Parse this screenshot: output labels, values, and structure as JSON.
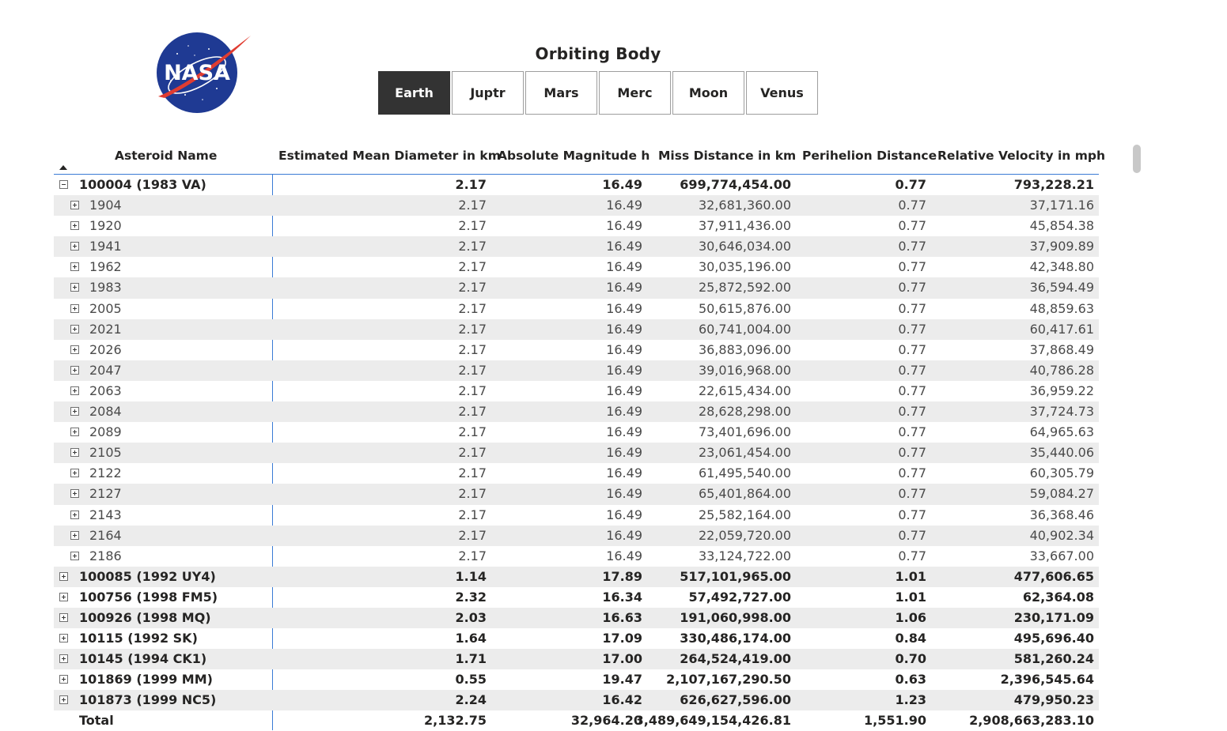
{
  "logo": {
    "text": "NASA"
  },
  "slicer": {
    "title": "Orbiting Body",
    "options": [
      "Earth",
      "Juptr",
      "Mars",
      "Merc",
      "Moon",
      "Venus"
    ],
    "selected": "Earth"
  },
  "table": {
    "columns": [
      "Asteroid Name",
      "Estimated Mean Diameter in km",
      "Absolute Magnitude h",
      "Miss Distance in km",
      "Perihelion Distance",
      "Relative Velocity in mph"
    ],
    "rows": [
      {
        "level": "parent",
        "expanded": true,
        "name": "100004 (1983 VA)",
        "diameter": "2.17",
        "magnitude": "16.49",
        "miss": "699,774,454.00",
        "perihelion": "0.77",
        "velocity": "793,228.21"
      },
      {
        "level": "child",
        "name": "1904",
        "diameter": "2.17",
        "magnitude": "16.49",
        "miss": "32,681,360.00",
        "perihelion": "0.77",
        "velocity": "37,171.16"
      },
      {
        "level": "child",
        "name": "1920",
        "diameter": "2.17",
        "magnitude": "16.49",
        "miss": "37,911,436.00",
        "perihelion": "0.77",
        "velocity": "45,854.38"
      },
      {
        "level": "child",
        "name": "1941",
        "diameter": "2.17",
        "magnitude": "16.49",
        "miss": "30,646,034.00",
        "perihelion": "0.77",
        "velocity": "37,909.89"
      },
      {
        "level": "child",
        "name": "1962",
        "diameter": "2.17",
        "magnitude": "16.49",
        "miss": "30,035,196.00",
        "perihelion": "0.77",
        "velocity": "42,348.80"
      },
      {
        "level": "child",
        "name": "1983",
        "diameter": "2.17",
        "magnitude": "16.49",
        "miss": "25,872,592.00",
        "perihelion": "0.77",
        "velocity": "36,594.49"
      },
      {
        "level": "child",
        "name": "2005",
        "diameter": "2.17",
        "magnitude": "16.49",
        "miss": "50,615,876.00",
        "perihelion": "0.77",
        "velocity": "48,859.63"
      },
      {
        "level": "child",
        "name": "2021",
        "diameter": "2.17",
        "magnitude": "16.49",
        "miss": "60,741,004.00",
        "perihelion": "0.77",
        "velocity": "60,417.61"
      },
      {
        "level": "child",
        "name": "2026",
        "diameter": "2.17",
        "magnitude": "16.49",
        "miss": "36,883,096.00",
        "perihelion": "0.77",
        "velocity": "37,868.49"
      },
      {
        "level": "child",
        "name": "2047",
        "diameter": "2.17",
        "magnitude": "16.49",
        "miss": "39,016,968.00",
        "perihelion": "0.77",
        "velocity": "40,786.28"
      },
      {
        "level": "child",
        "name": "2063",
        "diameter": "2.17",
        "magnitude": "16.49",
        "miss": "22,615,434.00",
        "perihelion": "0.77",
        "velocity": "36,959.22"
      },
      {
        "level": "child",
        "name": "2084",
        "diameter": "2.17",
        "magnitude": "16.49",
        "miss": "28,628,298.00",
        "perihelion": "0.77",
        "velocity": "37,724.73"
      },
      {
        "level": "child",
        "name": "2089",
        "diameter": "2.17",
        "magnitude": "16.49",
        "miss": "73,401,696.00",
        "perihelion": "0.77",
        "velocity": "64,965.63"
      },
      {
        "level": "child",
        "name": "2105",
        "diameter": "2.17",
        "magnitude": "16.49",
        "miss": "23,061,454.00",
        "perihelion": "0.77",
        "velocity": "35,440.06"
      },
      {
        "level": "child",
        "name": "2122",
        "diameter": "2.17",
        "magnitude": "16.49",
        "miss": "61,495,540.00",
        "perihelion": "0.77",
        "velocity": "60,305.79"
      },
      {
        "level": "child",
        "name": "2127",
        "diameter": "2.17",
        "magnitude": "16.49",
        "miss": "65,401,864.00",
        "perihelion": "0.77",
        "velocity": "59,084.27"
      },
      {
        "level": "child",
        "name": "2143",
        "diameter": "2.17",
        "magnitude": "16.49",
        "miss": "25,582,164.00",
        "perihelion": "0.77",
        "velocity": "36,368.46"
      },
      {
        "level": "child",
        "name": "2164",
        "diameter": "2.17",
        "magnitude": "16.49",
        "miss": "22,059,720.00",
        "perihelion": "0.77",
        "velocity": "40,902.34"
      },
      {
        "level": "child",
        "name": "2186",
        "diameter": "2.17",
        "magnitude": "16.49",
        "miss": "33,124,722.00",
        "perihelion": "0.77",
        "velocity": "33,667.00"
      },
      {
        "level": "parent",
        "expanded": false,
        "name": "100085 (1992 UY4)",
        "diameter": "1.14",
        "magnitude": "17.89",
        "miss": "517,101,965.00",
        "perihelion": "1.01",
        "velocity": "477,606.65"
      },
      {
        "level": "parent",
        "expanded": false,
        "name": "100756 (1998 FM5)",
        "diameter": "2.32",
        "magnitude": "16.34",
        "miss": "57,492,727.00",
        "perihelion": "1.01",
        "velocity": "62,364.08"
      },
      {
        "level": "parent",
        "expanded": false,
        "name": "100926 (1998 MQ)",
        "diameter": "2.03",
        "magnitude": "16.63",
        "miss": "191,060,998.00",
        "perihelion": "1.06",
        "velocity": "230,171.09"
      },
      {
        "level": "parent",
        "expanded": false,
        "name": "10115 (1992 SK)",
        "diameter": "1.64",
        "magnitude": "17.09",
        "miss": "330,486,174.00",
        "perihelion": "0.84",
        "velocity": "495,696.40"
      },
      {
        "level": "parent",
        "expanded": false,
        "name": "10145 (1994 CK1)",
        "diameter": "1.71",
        "magnitude": "17.00",
        "miss": "264,524,419.00",
        "perihelion": "0.70",
        "velocity": "581,260.24"
      },
      {
        "level": "parent",
        "expanded": false,
        "name": "101869 (1999 MM)",
        "diameter": "0.55",
        "magnitude": "19.47",
        "miss": "2,107,167,290.50",
        "perihelion": "0.63",
        "velocity": "2,396,545.64"
      },
      {
        "level": "parent",
        "expanded": false,
        "name": "101873 (1999 NC5)",
        "diameter": "2.24",
        "magnitude": "16.42",
        "miss": "626,627,596.00",
        "perihelion": "1.23",
        "velocity": "479,950.23"
      }
    ],
    "total": {
      "name": "Total",
      "diameter": "2,132.75",
      "magnitude": "32,964.20",
      "miss": "3,489,649,154,426.81",
      "perihelion": "1,551.90",
      "velocity": "2,908,663,283.10"
    }
  }
}
